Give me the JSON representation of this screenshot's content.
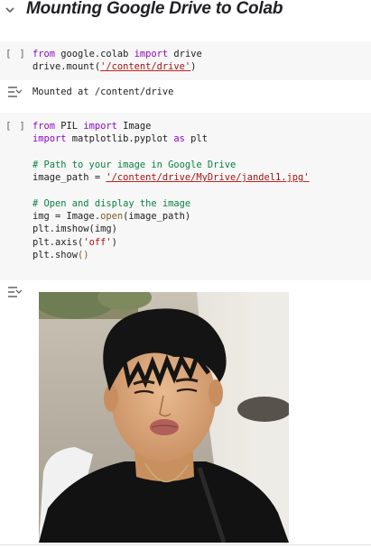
{
  "section": {
    "title": "Mounting Google Drive to Colab",
    "chevron_icon": "chevron-down-icon"
  },
  "cell1": {
    "run_label": "[ ]",
    "line1": {
      "kw1": "from",
      "mod": " google.colab ",
      "kw2": "import",
      "name": " drive"
    },
    "line2": {
      "pre": "drive.mount(",
      "str": "'/content/drive'",
      "post": ")"
    },
    "output": "Mounted at /content/drive"
  },
  "cell2": {
    "run_label": "[ ]",
    "line1": {
      "kw1": "from",
      "mod": " PIL ",
      "kw2": "import",
      "name": " Image"
    },
    "line2": {
      "kw1": "import",
      "mod": " matplotlib.pyplot ",
      "kw2": "as",
      "name": " plt"
    },
    "comment1": "# Path to your image in Google Drive",
    "line4": {
      "pre": "image_path = ",
      "str": "'/content/drive/MyDrive/jandel1.jpg'"
    },
    "comment2": "# Open and display the image",
    "line6": {
      "pre": "img = Image.",
      "fn": "open",
      "post": "(image_path)"
    },
    "line7": "plt.imshow(img)",
    "line8": {
      "pre": "plt.axis(",
      "str": "'off'",
      "post": ")"
    },
    "line9": {
      "pre": "plt.show",
      "fn": "()"
    }
  },
  "colors": {
    "keyword": "#8f08c4",
    "string": "#a31515",
    "comment": "#0b8043",
    "cell_bg": "#f7f7f7"
  }
}
